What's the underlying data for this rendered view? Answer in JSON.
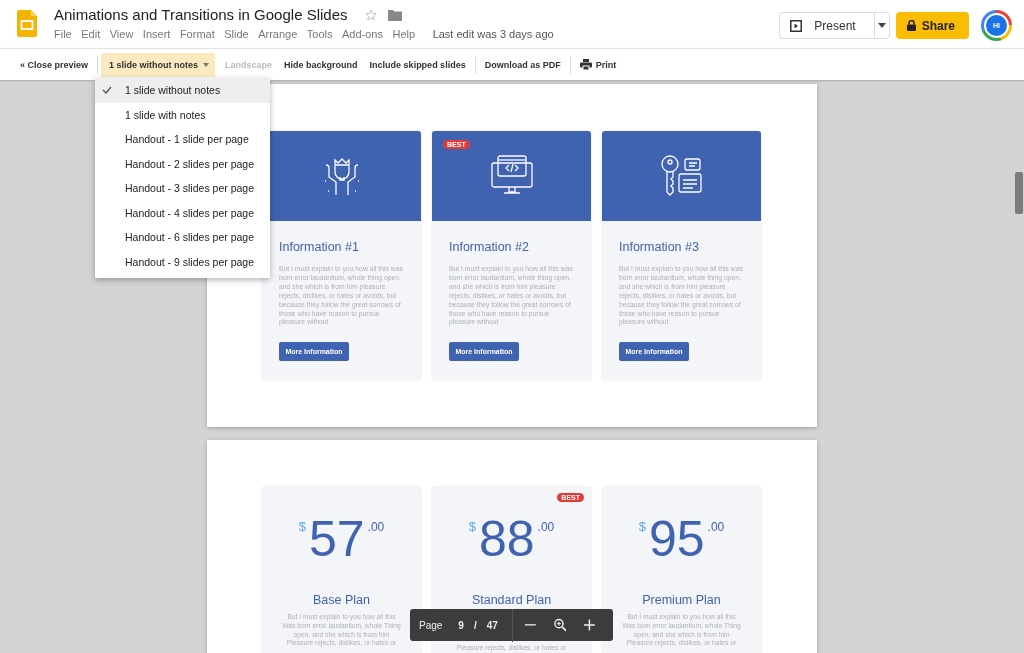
{
  "document": {
    "title": "Animations and Transitions in Google Slides",
    "menu": [
      "File",
      "Edit",
      "View",
      "Insert",
      "Format",
      "Slide",
      "Arrange",
      "Tools",
      "Add-ons",
      "Help"
    ],
    "last_edit": "Last edit was 3 days ago"
  },
  "header_actions": {
    "present": "Present",
    "share": "Share",
    "avatar": "HI"
  },
  "toolbar": {
    "items": [
      {
        "kind": "button",
        "label": "« Close preview",
        "disabled": false
      },
      {
        "kind": "divider"
      },
      {
        "kind": "dropdown",
        "label": "1 slide without notes",
        "expanded": true
      },
      {
        "kind": "button",
        "label": "Landscape",
        "disabled": true
      },
      {
        "kind": "button",
        "label": "Hide background",
        "disabled": false
      },
      {
        "kind": "button",
        "label": "Include skipped slides",
        "disabled": false
      },
      {
        "kind": "divider"
      },
      {
        "kind": "button",
        "label": "Download as PDF",
        "disabled": false
      },
      {
        "kind": "divider"
      },
      {
        "kind": "print",
        "label": "Print",
        "disabled": false
      }
    ]
  },
  "layout_menu": {
    "items": [
      {
        "label": "1 slide without notes",
        "selected": true
      },
      {
        "label": "1 slide with notes",
        "selected": false
      },
      {
        "label": "Handout - 1 slide per page",
        "selected": false
      },
      {
        "label": "Handout - 2 slides per page",
        "selected": false
      },
      {
        "label": "Handout - 3 slides per page",
        "selected": false
      },
      {
        "label": "Handout - 4 slides per page",
        "selected": false
      },
      {
        "label": "Handout - 6 slides per page",
        "selected": false
      },
      {
        "label": "Handout - 9 slides per page",
        "selected": false
      }
    ]
  },
  "slides": [
    {
      "kind": "info",
      "cards": [
        {
          "title": "Information #1",
          "text": "But I must explain to you how all this was born error laudantium, whole thing open, and she which is from him pleasure rejects, dislikes, or hates or avoids, but because they follow the great sorrows of those who have reason to pursue pleasure without",
          "button": "More Information"
        },
        {
          "badge": "BEST",
          "title": "Information #2",
          "text": "But I must explain to you how all this was born error laudantium, whole thing open, and she which is from him pleasure rejects, dislikes, or hates or avoids, but because they follow the great sorrows of those who have reason to pursue pleasure without",
          "button": "More Information"
        },
        {
          "title": "Information #3",
          "text": "But I must explain to you how all this was born error laudantium, whole thing open, and she which is from him pleasure rejects, dislikes, or hates or avoids, but because they follow the great sorrows of those who have reason to pursue pleasure without",
          "button": "More Information"
        }
      ]
    },
    {
      "kind": "pricing",
      "cards": [
        {
          "currency": "$",
          "amount": "57",
          "cents": ".00",
          "title": "Base Plan",
          "text": "But I must explain to you how all this Was born error laudantium, whole Thing open, and she which is from him Pleasure rejects, dislikes, or hates or"
        },
        {
          "currency": "$",
          "amount": "88",
          "cents": ".00",
          "badge": "BEST",
          "title": "Standard Plan",
          "text": "Pleasure rejects, dislikes, or hates or"
        },
        {
          "currency": "$",
          "amount": "95",
          "cents": ".00",
          "title": "Premium Plan",
          "text": "But I must explain to you how all this Was born error laudantium, whole Thing open, and she which is from him Pleasure rejects, dislikes, or hates or"
        }
      ]
    }
  ],
  "page_nav": {
    "label": "Page",
    "current": "9",
    "separator": "/",
    "total": "47"
  }
}
